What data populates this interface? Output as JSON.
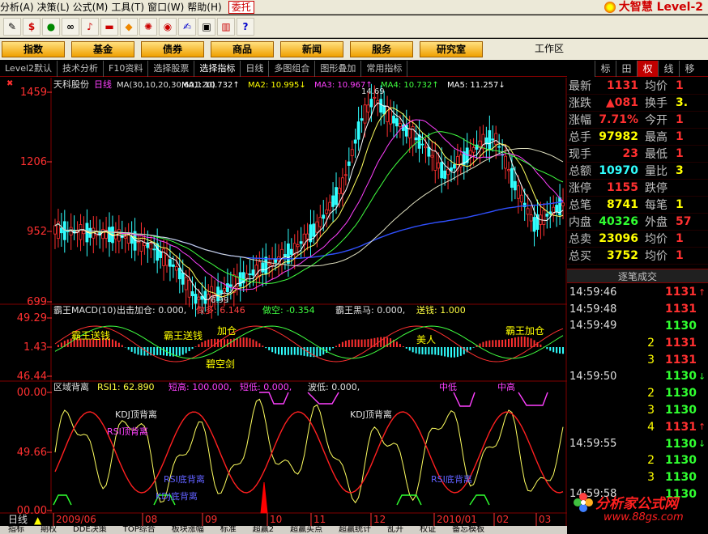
{
  "menu": {
    "items": [
      "分析(A)",
      "决策(L)",
      "公式(M)",
      "工具(T)",
      "窗口(W)",
      "帮助(H)"
    ],
    "entrust": "委托",
    "brand": "大智慧 Level-2"
  },
  "toolbar": {
    "icons": [
      "ruler-icon",
      "dollar-icon",
      "signal-icon",
      "binoculars-icon",
      "bell-icon",
      "rectangle-icon",
      "diamond-icon",
      "fire-icon",
      "globe-icon",
      "edit-icon",
      "screen-icon",
      "book-icon",
      "help-icon"
    ]
  },
  "nav": {
    "buttons": [
      "指数",
      "基金",
      "债券",
      "商品",
      "新闻",
      "服务",
      "研究室"
    ],
    "workspace": "工作区"
  },
  "chart_bar": {
    "items": [
      "Level2默认",
      "技术分析",
      "F10资料",
      "选择股票",
      "选择指标",
      "日线",
      "多图组合",
      "图形叠加",
      "常用指标"
    ]
  },
  "side_tabs": [
    "标",
    "田",
    "权",
    "线",
    "移"
  ],
  "main_chart": {
    "stock": "天科股份",
    "period": "日线",
    "ma_header": "MA(30,10,20,30,60,120)",
    "ma_labels": [
      {
        "label": "MA1: 10.732",
        "arrow": "↑",
        "color": "#ffffff"
      },
      {
        "label": "MA2: 10.995",
        "arrow": "↓",
        "color": "#ffff00"
      },
      {
        "label": "MA3: 10.967",
        "arrow": "↑",
        "color": "#ff40ff"
      },
      {
        "label": "MA4: 10.732",
        "arrow": "↑",
        "color": "#40ff40"
      },
      {
        "label": "MA5: 11.257",
        "arrow": "↓",
        "color": "#ffffff"
      }
    ],
    "y_ticks": [
      "1459",
      "1206",
      "952",
      "699"
    ],
    "high_label": "14.69",
    "low_label": "6.99"
  },
  "macd": {
    "header": "霸王MACD(10)",
    "buy": "出击加仓: 0.000,",
    "long": "做多: 6.146",
    "short": "做空: -0.354",
    "black": "霸王黑马: 0.000,",
    "sell": "送钱: 1.000",
    "y_ticks": [
      "49.29",
      "1.43",
      "46.44"
    ],
    "signals": [
      "霸王送钱",
      "霸王送钱",
      "加仓",
      "碧空剑",
      "美人",
      "霸王加仓"
    ]
  },
  "rsi": {
    "header": "区域背离",
    "rsi1": "RSI1: 62.890",
    "short_high": "短高: 100.000,",
    "short_low": "短低: 0.000,",
    "wave_low": "波低: 0.000,",
    "mid_low": "中低",
    "mid_high": "中高",
    "y_ticks": [
      "00.00",
      "49.66",
      "00.00"
    ],
    "signals": [
      "KDJ顶背离",
      "RSI顶背离",
      "KDJ顶背离",
      "RSI底背离",
      "KDJ底背离",
      "RSI底背离"
    ]
  },
  "x_axis": {
    "period_label": "日线",
    "labels": [
      "2009/06",
      "08",
      "09",
      "10",
      "11",
      "12",
      "2010/01",
      "02",
      "03"
    ]
  },
  "quote": {
    "rows": [
      {
        "l": "最新",
        "v": "1131",
        "vc": "#ff3030",
        "l2": "均价",
        "v2": "1",
        "v2c": "#ff3030"
      },
      {
        "l": "涨跌",
        "v": "▲081",
        "vc": "#ff3030",
        "l2": "换手",
        "v2": "3.",
        "v2c": "#ffff00"
      },
      {
        "l": "涨幅",
        "v": "7.71%",
        "vc": "#ff3030",
        "l2": "今开",
        "v2": "1",
        "v2c": "#ff3030"
      },
      {
        "l": "总手",
        "v": "97982",
        "vc": "#ffff00",
        "l2": "最高",
        "v2": "1",
        "v2c": "#ff3030"
      },
      {
        "l": "现手",
        "v": "23",
        "vc": "#ff3030",
        "l2": "最低",
        "v2": "1",
        "v2c": "#ff3030"
      },
      {
        "l": "总额",
        "v": "10970",
        "vc": "#30ffff",
        "l2": "量比",
        "v2": "3",
        "v2c": "#ffff00"
      },
      {
        "l": "涨停",
        "v": "1155",
        "vc": "#ff3030",
        "l2": "跌停",
        "v2": "",
        "v2c": "#30ff30"
      },
      {
        "l": "总笔",
        "v": "8741",
        "vc": "#ffff00",
        "l2": "每笔",
        "v2": "1",
        "v2c": "#ffff00"
      },
      {
        "l": "内盘",
        "v": "40326",
        "vc": "#30ff30",
        "l2": "外盘",
        "v2": "57",
        "v2c": "#ff3030"
      },
      {
        "l": "总卖",
        "v": "23096",
        "vc": "#ffff00",
        "l2": "均价",
        "v2": "1",
        "v2c": "#ff3030"
      },
      {
        "l": "总买",
        "v": "3752",
        "vc": "#ffff00",
        "l2": "均价",
        "v2": "1",
        "v2c": "#ff3030"
      }
    ],
    "deals_title": "逐笔成交",
    "deals": [
      {
        "t": "14:59:46",
        "v": "",
        "p": "1131",
        "a": "↑",
        "g": false
      },
      {
        "t": "14:59:48",
        "v": "",
        "p": "1131",
        "a": "",
        "g": false
      },
      {
        "t": "14:59:49",
        "v": "",
        "p": "1130",
        "a": "",
        "g": true
      },
      {
        "t": "",
        "v": "2",
        "p": "1131",
        "a": "",
        "g": false
      },
      {
        "t": "",
        "v": "3",
        "p": "1131",
        "a": "",
        "g": false
      },
      {
        "t": "14:59:50",
        "v": "",
        "p": "1130",
        "a": "↓",
        "g": true
      },
      {
        "t": "",
        "v": "2",
        "p": "1130",
        "a": "",
        "g": true
      },
      {
        "t": "",
        "v": "3",
        "p": "1130",
        "a": "",
        "g": true
      },
      {
        "t": "",
        "v": "4",
        "p": "1131",
        "a": "↑",
        "g": false
      },
      {
        "t": "14:59:55",
        "v": "",
        "p": "1130",
        "a": "↓",
        "g": true
      },
      {
        "t": "",
        "v": "2",
        "p": "1130",
        "a": "",
        "g": true
      },
      {
        "t": "",
        "v": "3",
        "p": "1130",
        "a": "",
        "g": true
      },
      {
        "t": "14:59:58",
        "v": "",
        "p": "1130",
        "a": "",
        "g": true
      }
    ]
  },
  "status": {
    "tabs": [
      "指标",
      "期权",
      "DDE决策",
      "TOP综合",
      "板块涨幅",
      "标准",
      "超赢2",
      "超赢买点",
      "超赢统计",
      "乱开",
      "权证",
      "备忘模板"
    ]
  },
  "watermark": {
    "t1": "分析家公式网",
    "t2": "www.88gs.com"
  }
}
